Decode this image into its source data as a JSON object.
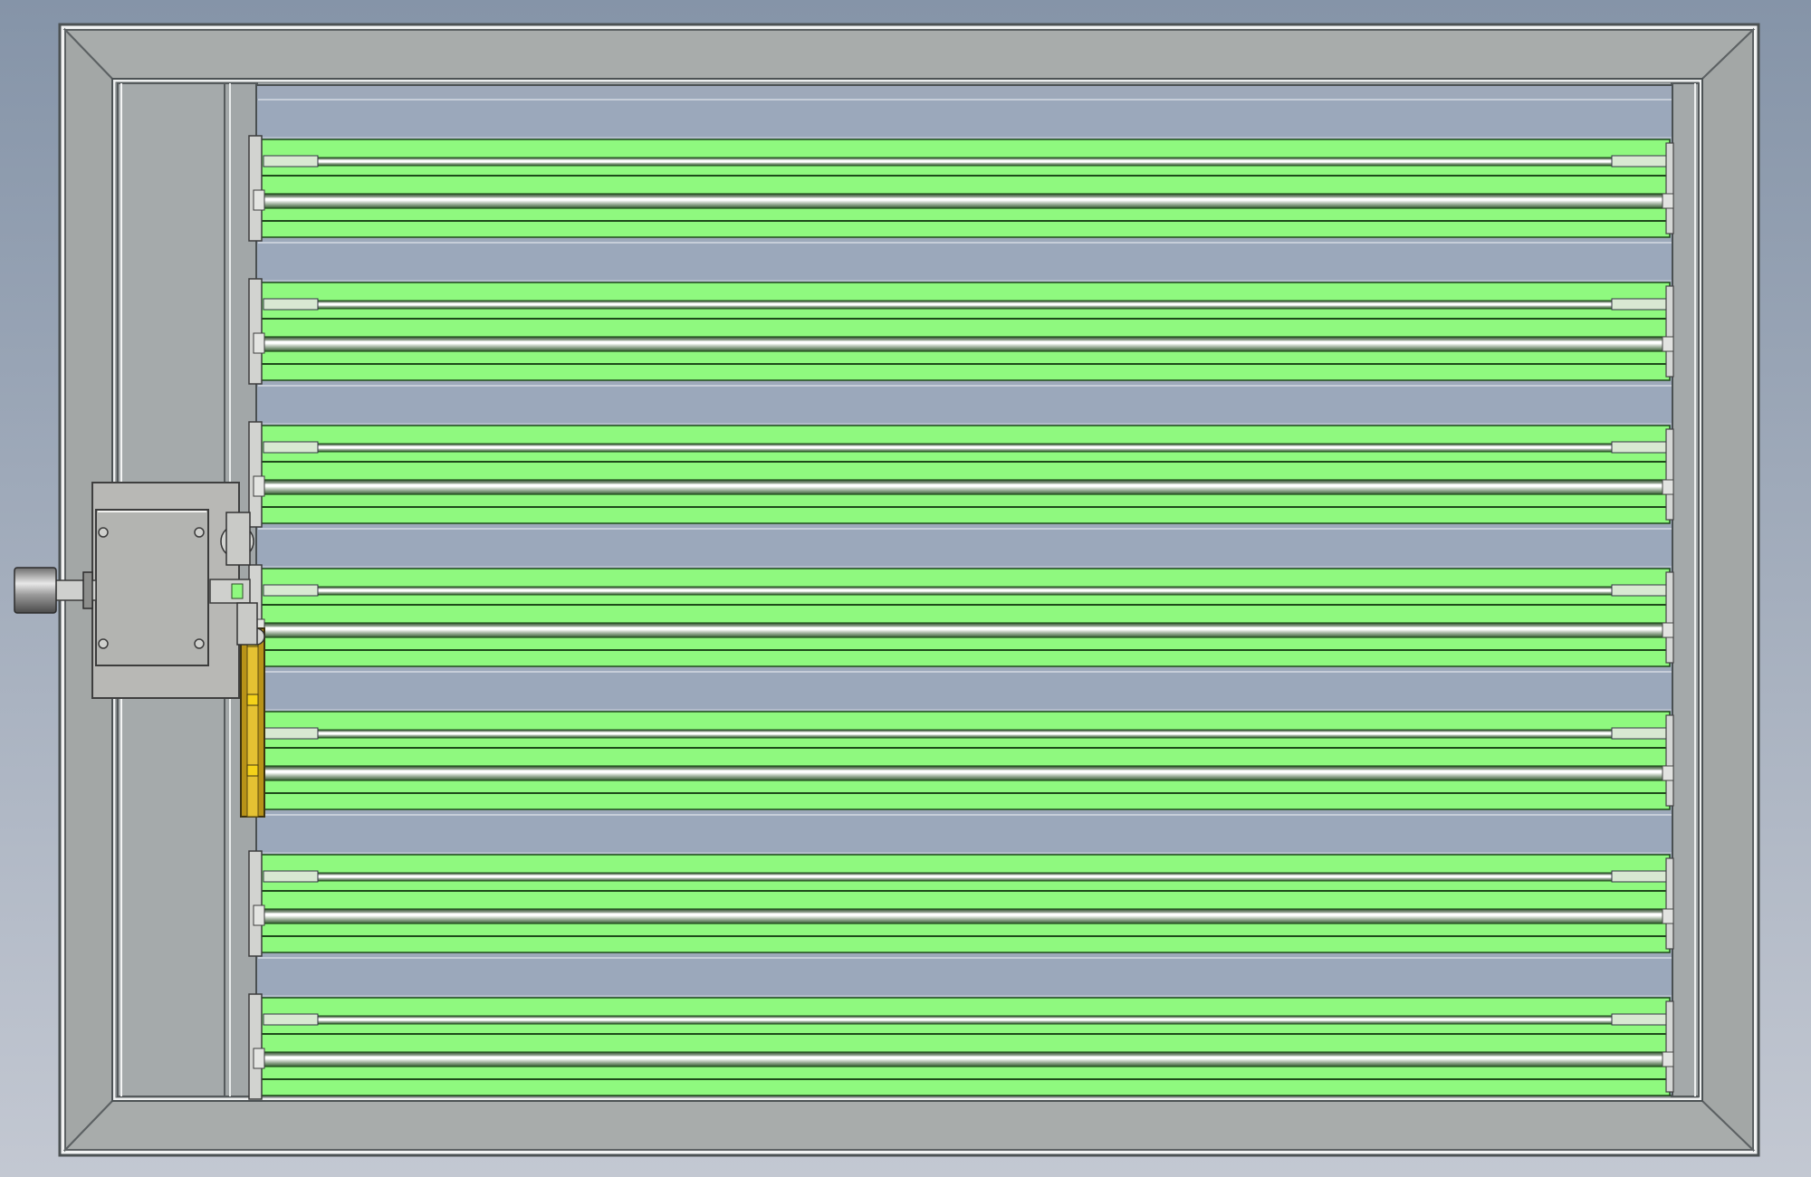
{
  "scene": {
    "subject": "",
    "louver_blade_count": 7,
    "colors": {
      "background_top": "#8594a8",
      "background_bottom": "#c3c8d2",
      "frame_face": "#a7abaa",
      "frame_edge": "#f3f4f4",
      "frame_dark": "#5f6466",
      "blade_fill": "#8ff97f",
      "blade_dark": "#1e4a1a",
      "gap_fill": "#9ba8bb",
      "gap_strip": "#a9b3c3",
      "rod_light": "#ffffff",
      "rod_shadow": "#4a5a45",
      "actuator_plate": "#b9b9b7",
      "actuator_cap": "#cfd0ce",
      "linkage_gold": "#c9a21a",
      "linkage_yellow": "#f2cf11"
    }
  }
}
